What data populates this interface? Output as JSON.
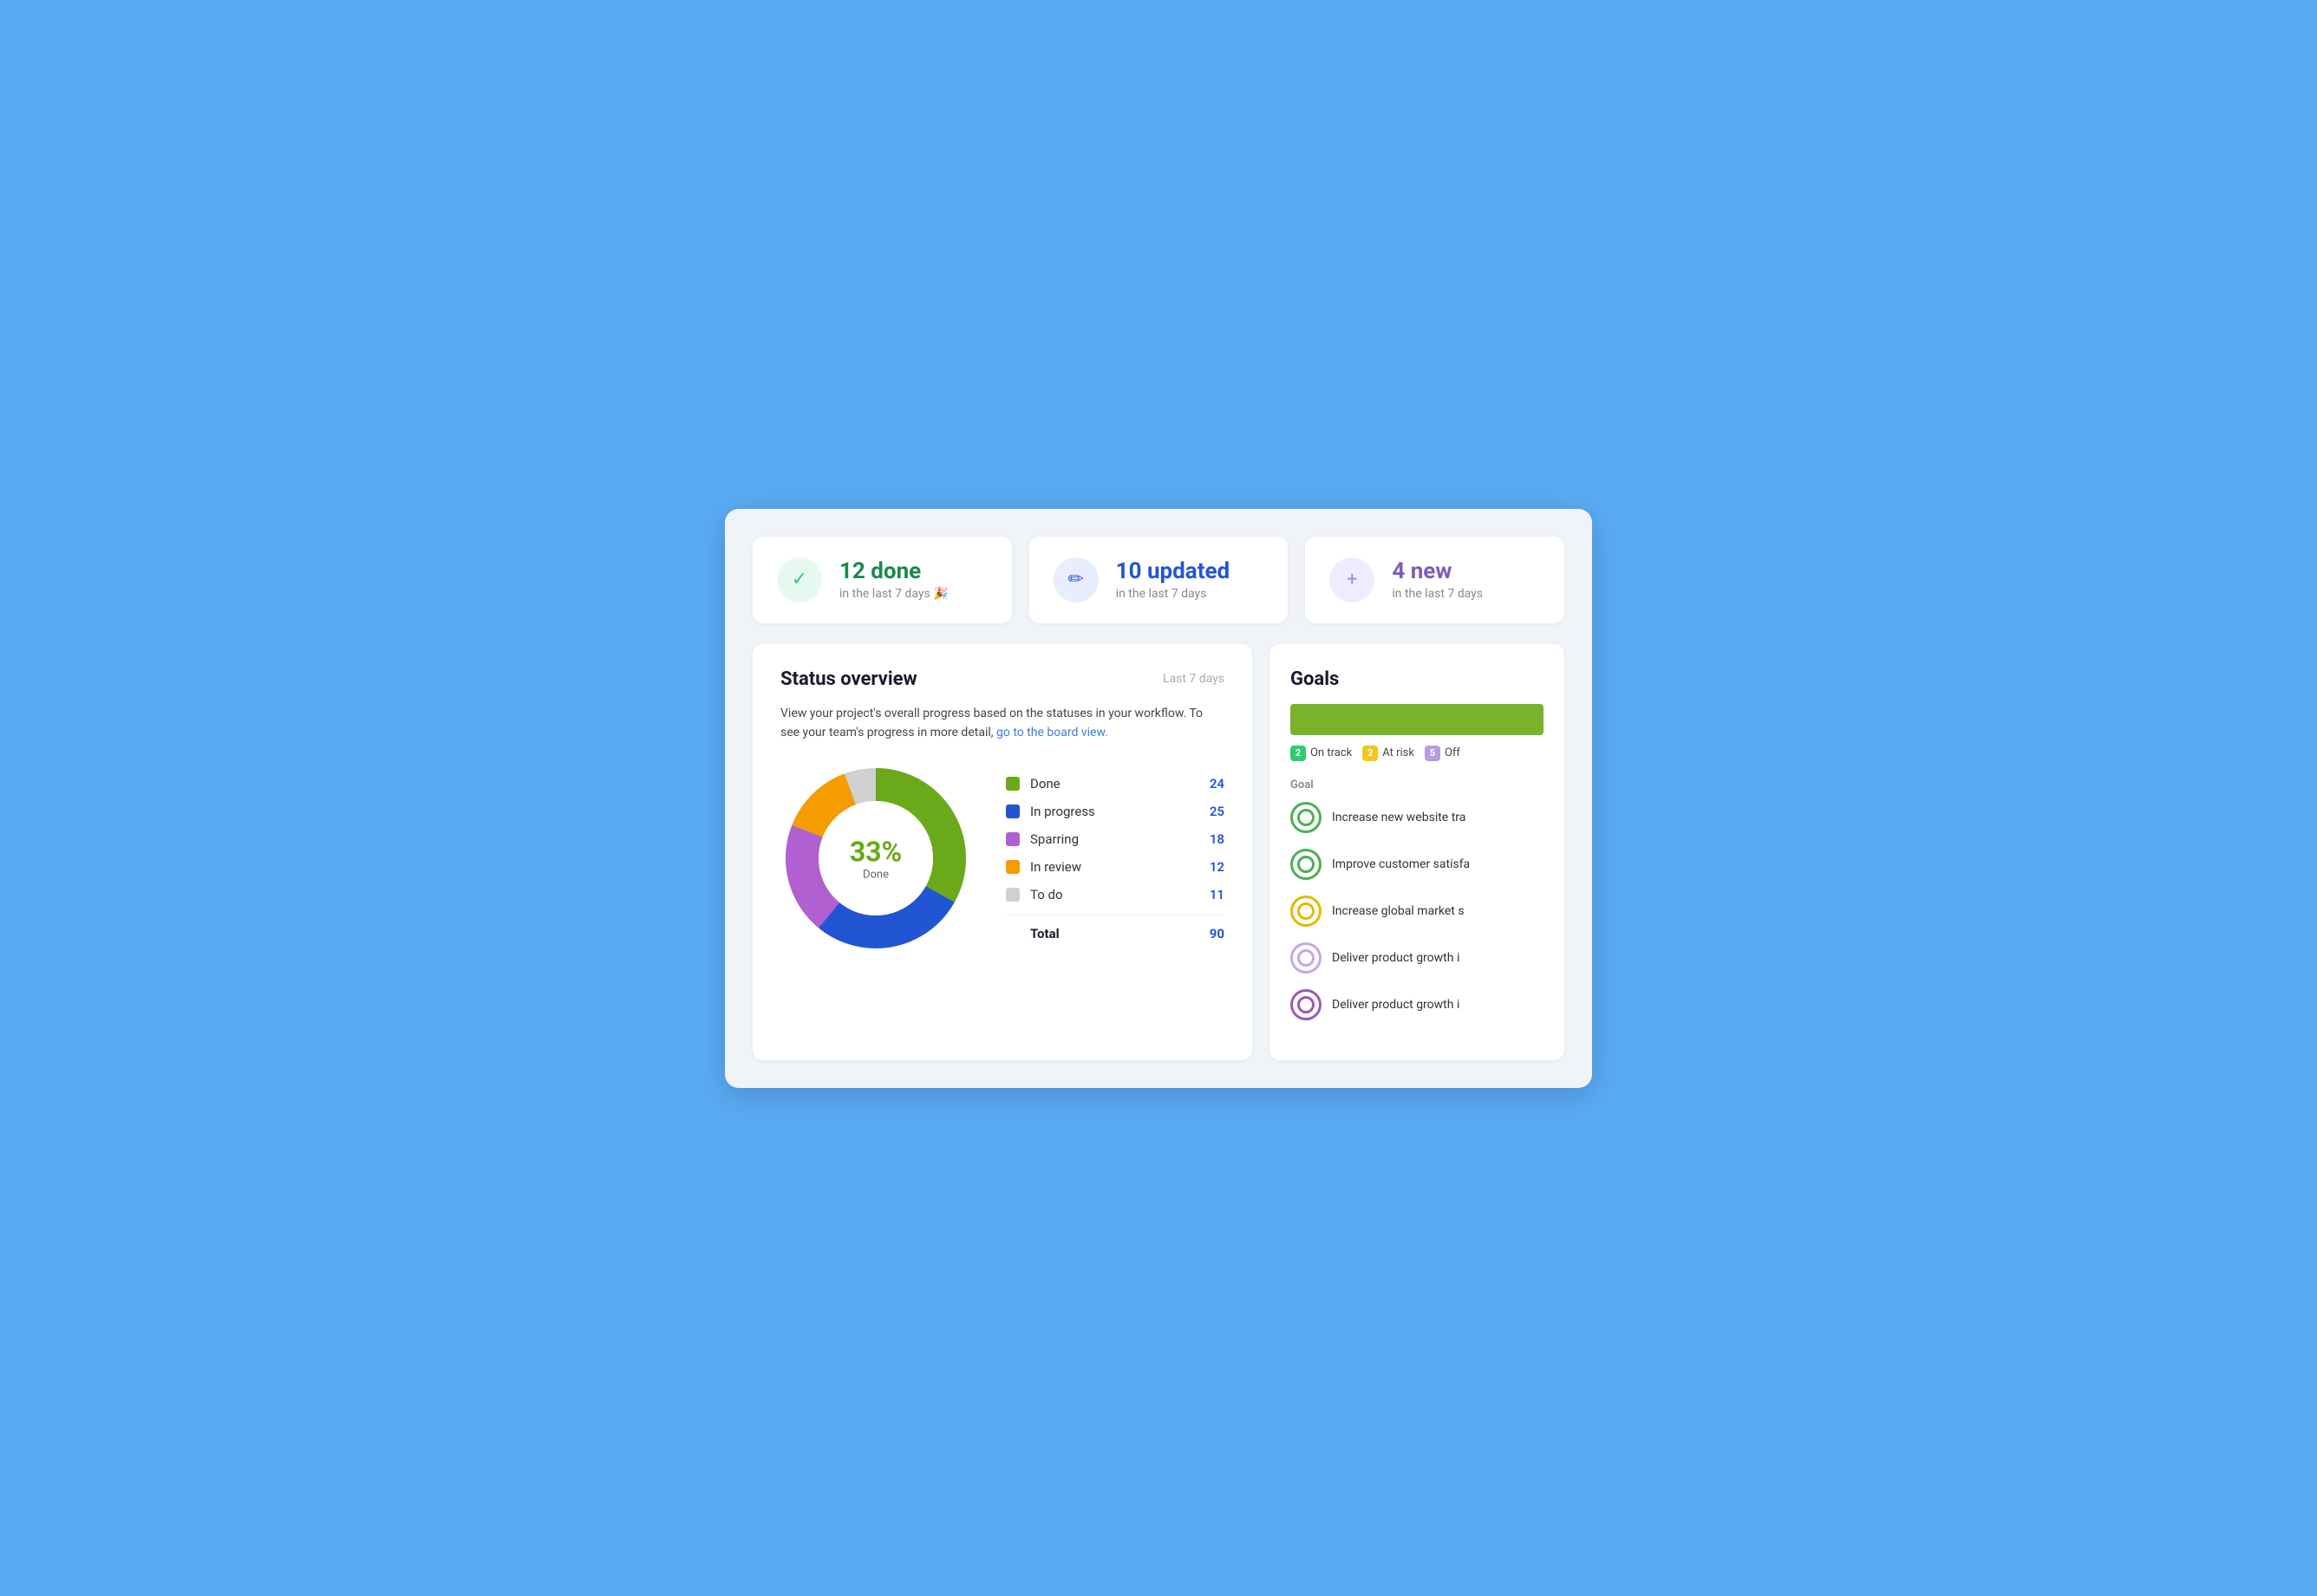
{
  "stat_cards": [
    {
      "id": "done",
      "icon_char": "✓",
      "icon_class": "green",
      "number": "12 done",
      "number_class": "green",
      "sub": "in the last 7 days 🎉"
    },
    {
      "id": "updated",
      "icon_char": "✏",
      "icon_class": "blue",
      "number": "10 updated",
      "number_class": "blue",
      "sub": "in the last 7 days"
    },
    {
      "id": "new",
      "icon_char": "+",
      "icon_class": "purple",
      "number": "4 new",
      "number_class": "purple",
      "sub": "in the last 7 days"
    }
  ],
  "status_panel": {
    "title": "Status overview",
    "period": "Last 7 days",
    "desc_part1": "View your project's overall progress based on the statuses in your workflow. To see your team's progress in more detail,",
    "desc_link": "go to the board view.",
    "donut": {
      "pct": "33%",
      "label": "Done",
      "segments": [
        {
          "label": "Done",
          "value": 24,
          "color": "#6aaa1a",
          "dash": 33,
          "offset": 0
        },
        {
          "label": "In progress",
          "value": 25,
          "color": "#2255d4",
          "dash": 27.8,
          "offset": 67
        },
        {
          "label": "Sparring",
          "value": 18,
          "color": "#b060d0",
          "dash": 20,
          "offset": 94.8
        },
        {
          "label": "In review",
          "value": 12,
          "color": "#f59c00",
          "dash": 13.3,
          "offset": 114.8
        },
        {
          "label": "To do",
          "value": 11,
          "color": "#d0d0d0",
          "dash": 12.2,
          "offset": 128.1
        }
      ]
    },
    "legend": [
      {
        "name": "Done",
        "value": "24",
        "color": "#6aaa1a"
      },
      {
        "name": "In progress",
        "value": "25",
        "color": "#2255d4"
      },
      {
        "name": "Sparring",
        "value": "18",
        "color": "#b060d0"
      },
      {
        "name": "In review",
        "value": "12",
        "color": "#f59c00"
      },
      {
        "name": "To do",
        "value": "11",
        "color": "#d0d0d0"
      }
    ],
    "total_label": "Total",
    "total_value": "90"
  },
  "goals_panel": {
    "title": "Goals",
    "statuses": [
      {
        "count": "2",
        "label": "On track",
        "class": "green"
      },
      {
        "count": "2",
        "label": "At risk",
        "class": "yellow"
      },
      {
        "count": "5",
        "label": "Off",
        "class": "purple"
      }
    ],
    "col_header": "Goal",
    "items": [
      {
        "name": "Increase new website tra",
        "icon_class": "green"
      },
      {
        "name": "Improve customer satisfa",
        "icon_class": "green"
      },
      {
        "name": "Increase global market s",
        "icon_class": "yellow"
      },
      {
        "name": "Deliver product growth i",
        "icon_class": "purple-light"
      },
      {
        "name": "Deliver product growth i",
        "icon_class": "purple"
      }
    ]
  }
}
